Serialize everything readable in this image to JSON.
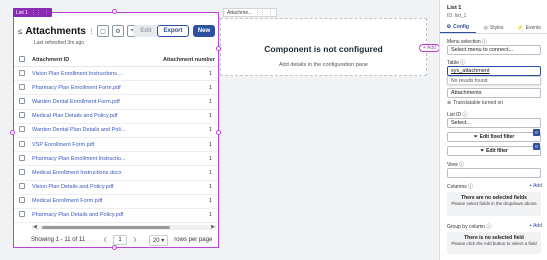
{
  "list": {
    "tag_label": "List 1",
    "title": "Attachments",
    "refreshed": "Last refreshed 3m ago",
    "edit_label": "Edit",
    "export_label": "Export",
    "new_label": "New",
    "columns": [
      "Attachment ID",
      "Attachment number"
    ],
    "rows": [
      {
        "name": "Vision Plan Enrollment Instructions....",
        "num": "1"
      },
      {
        "name": "Pharmacy Plan Enrollment Form.pdf",
        "num": "1"
      },
      {
        "name": "Warden Dental Enrollment Form.pdf",
        "num": "1"
      },
      {
        "name": "Medical Plan Details and Policy.pdf",
        "num": "1"
      },
      {
        "name": "Warden Dental Plan Details and Poli...",
        "num": "1"
      },
      {
        "name": "VSP Enrollment Form.pdf",
        "num": "1"
      },
      {
        "name": "Pharmacy Plan Enrollment Instructio...",
        "num": "1"
      },
      {
        "name": "Medical Enrollment Instructions.docx",
        "num": "1"
      },
      {
        "name": "Vision Plan Details and Policy.pdf",
        "num": "1"
      },
      {
        "name": "Medical Enrollment Form.pdf",
        "num": "1"
      },
      {
        "name": "Pharmacy Plan Details and Policy.pdf",
        "num": "1"
      }
    ],
    "showing": "Showing 1 - 11 of 11",
    "page": "1",
    "per_page": "20",
    "rows_per_page": "rows per page"
  },
  "attachment": {
    "tag_label": "Attachme...",
    "title": "Component is not configured",
    "subtitle": "Add details in the configuration pane",
    "add_label": "+ Add"
  },
  "panel": {
    "title": "List 1",
    "id": "ID: list_1",
    "tabs": [
      "Config",
      "Styles",
      "Events"
    ],
    "menu_label": "Menu selection",
    "menu_value": "Select menu to connect...",
    "table_label": "Table",
    "table_value": "sys_attachment",
    "no_results": "No results found",
    "title_field_value": "Attachments",
    "translatable": "Translatable turned on",
    "list_id_label": "List ID",
    "list_id_value": "Select...",
    "edit_fixed_filter": "Edit fixed filter",
    "edit_filter": "Edit filter",
    "badge": "0",
    "view_label": "View",
    "columns_label": "Columns",
    "add": "+ Add",
    "no_fields_title": "There are no selected fields",
    "no_fields_sub": "Please select fields in the dropdown above",
    "group_label": "Group by column",
    "no_field_title": "There is no selected field",
    "no_field_sub": "Please click the Add button to select a field"
  },
  "colors": {
    "accent": "#2c4fa0",
    "selection": "#b844d6",
    "link": "#3b57b8"
  }
}
